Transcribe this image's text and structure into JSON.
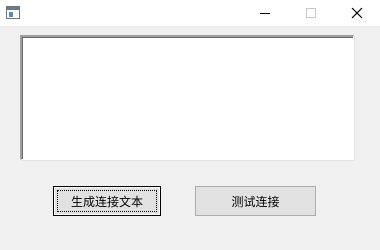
{
  "window": {
    "title": "",
    "controls": {
      "minimize_icon": "minimize-icon",
      "maximize_icon": "maximize-icon",
      "close_icon": "close-icon"
    }
  },
  "main": {
    "text_area": {
      "value": ""
    },
    "buttons": {
      "generate_label": "生成连接文本",
      "test_label": "测试连接"
    }
  },
  "colors": {
    "window_bg": "#f0f0f0",
    "button_bg": "#e1e1e1",
    "button_border": "#adadad"
  }
}
